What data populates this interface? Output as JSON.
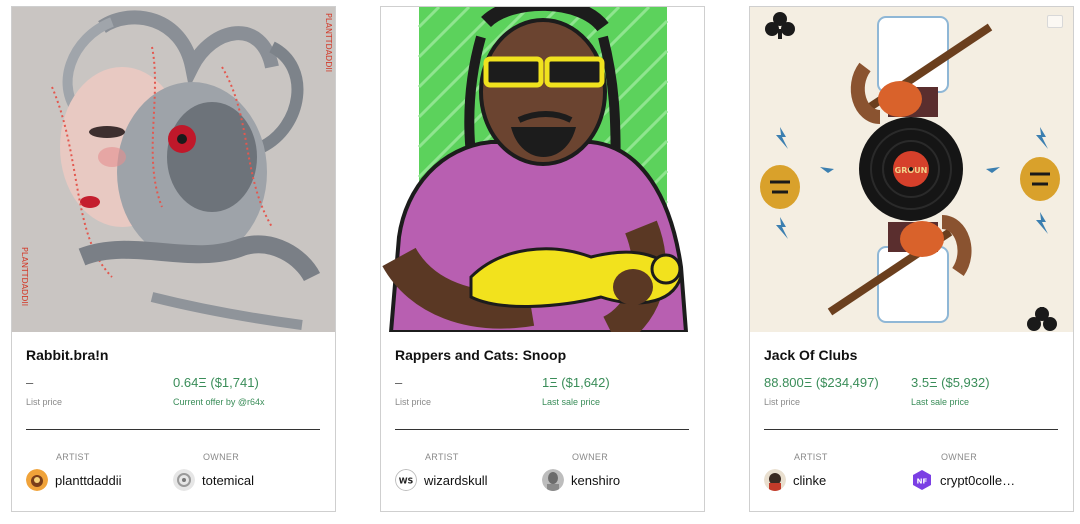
{
  "cards": [
    {
      "title": "Rabbit.bra!n",
      "price_a": {
        "value": "–",
        "label": "List price"
      },
      "price_b": {
        "value": "0.64Ξ ($1,741)",
        "label": "Current offer by @r64x"
      },
      "artist_label": "ARTIST",
      "artist": "planttdaddii",
      "owner_label": "OWNER",
      "owner": "totemical",
      "art_side_text": "PLANTTDADDII"
    },
    {
      "title": "Rappers and Cats: Snoop",
      "price_a": {
        "value": "–",
        "label": "List price"
      },
      "price_b": {
        "value": "1Ξ ($1,642)",
        "label": "Last sale price"
      },
      "artist_label": "ARTIST",
      "artist": "wizardskull",
      "artist_avatar_text": "WS",
      "owner_label": "OWNER",
      "owner": "kenshiro"
    },
    {
      "title": "Jack Of Clubs",
      "price_a": {
        "value": "88.800Ξ ($234,497)",
        "label": "List price"
      },
      "price_b": {
        "value": "3.5Ξ ($5,932)",
        "label": "Last sale price"
      },
      "artist_label": "ARTIST",
      "artist": "clinke",
      "owner_label": "OWNER",
      "owner": "crypt0colle…",
      "art_record_text": "GROUN"
    }
  ],
  "colors": {
    "price_green": "#3a8d59",
    "label_grey": "#8a8a8a",
    "snoop_bg_green": "#5cd25c",
    "snoop_shirt": "#b85fb1",
    "cat_yellow": "#f2e21d",
    "owner3_avatar": "#7b3fe4"
  },
  "icons": {
    "card3_corner": "video-toggle-icon"
  }
}
